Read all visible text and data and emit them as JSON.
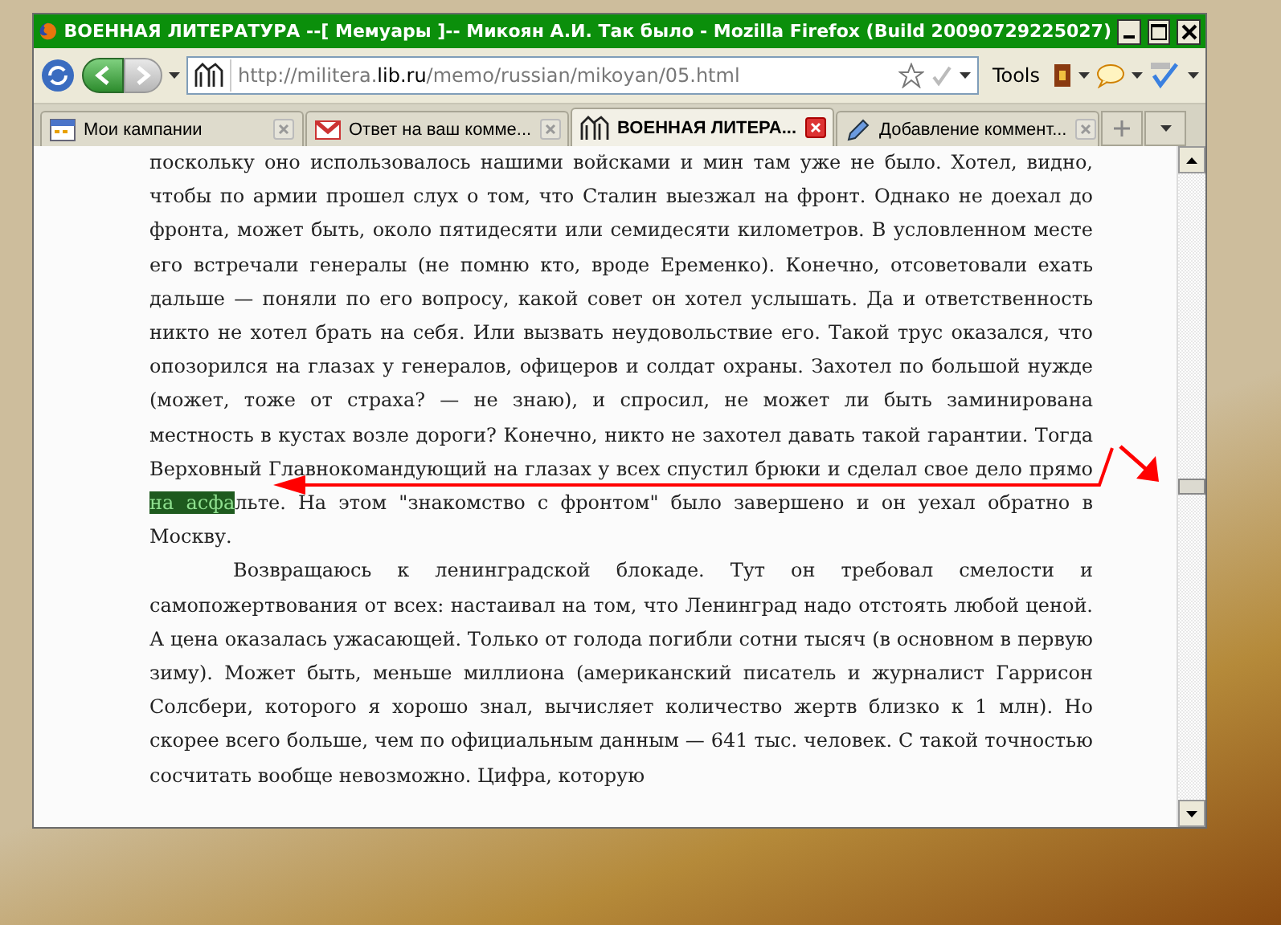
{
  "window": {
    "title": "ВОЕННАЯ ЛИТЕРАТУРА --[ Мемуары ]-- Микоян А.И. Так было - Mozilla Firefox (Build 20090729225027)"
  },
  "toolbar": {
    "url_host": "http://militera.",
    "url_domain": "lib.ru",
    "url_path": "/memo/russian/mikoyan/05.html",
    "tools_label": "Tools"
  },
  "tabs": [
    {
      "label": "Мои кампании",
      "selected": false,
      "kind": "calendar"
    },
    {
      "label": "Ответ на ваш комме...",
      "selected": false,
      "kind": "mail"
    },
    {
      "label": "ВОЕННАЯ ЛИТЕРА...",
      "selected": true,
      "kind": "site"
    },
    {
      "label": "Добавление коммент...",
      "selected": false,
      "kind": "pencil"
    }
  ],
  "paragraphs": [
    {
      "indent": false,
      "segments": [
        {
          "text": "поскольку оно использовалось нашими войсками и мин там уже не было. Хотел, видно, чтобы по армии прошел слух о том, что Сталин выезжал на фронт. Однако не доехал до фронта, может быть, около пятидесяти или семидесяти километров. В условленном месте его встречали генералы (не помню кто, вроде Еременко). Конечно, отсоветовали ехать дальше — поняли по его вопросу, какой совет он хотел услышать. Да и ответственность никто не хотел брать на себя. Или вызвать неудовольствие его. Такой трус оказался, что опозорился на глазах у генералов, офицеров и солдат охраны. Захотел по большой нужде (может, тоже от страха? — не знаю), и спросил, не может ли быть заминирована местность в кустах возле дороги? Конечно, никто не захотел давать такой гарантии. Тогда Верховный Главнокомандующий на глазах у всех спустил брюки и сделал свое дело прямо ",
          "highlighted": false
        },
        {
          "text": "на асфа",
          "highlighted": true
        },
        {
          "text": "льте. На этом \"знакомство с фронтом\" было завершено и он уехал обратно в Москву.",
          "highlighted": false
        }
      ]
    },
    {
      "indent": true,
      "segments": [
        {
          "text": "Возвращаюсь к ленинградской блокаде. Тут он требовал смелости и самопожертвования от всех: настаивал на том, что Ленинград надо отстоять любой ценой. А цена оказалась ужасающей. Только от голода погибли сотни тысяч (в основном в первую зиму). Может быть, меньше миллиона (американский писатель и журналист Гаррисон Солсбери, которого я хорошо знал, вычисляет количество жертв близко к 1 млн). Но скорее всего больше, чем по официальным данным — 641 тыс. человек. С такой точностью сосчитать вообще невозможно. Цифра, которую",
          "highlighted": false
        }
      ]
    }
  ]
}
